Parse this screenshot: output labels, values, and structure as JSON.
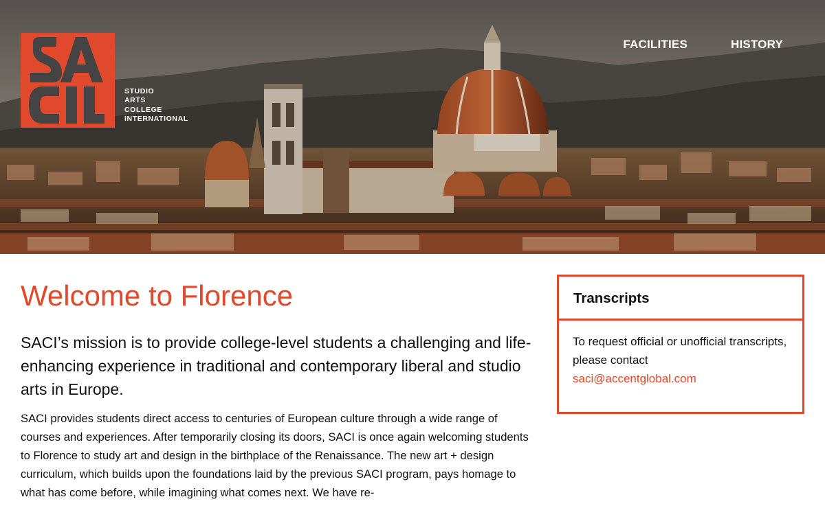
{
  "brand": {
    "logo_letters": "SACI",
    "tagline_lines": [
      "STUDIO",
      "ARTS",
      "COLLEGE",
      "INTERNATIONAL"
    ],
    "accent_color": "#e0492b"
  },
  "nav": {
    "items": [
      {
        "label": "FACILITIES"
      },
      {
        "label": "HISTORY"
      }
    ]
  },
  "hero": {
    "image": "florence-duomo-cityscape"
  },
  "main": {
    "title": "Welcome to Florence",
    "lead": "SACI’s mission is to provide college-level students a challenging and life-enhancing experience in traditional and contemporary liberal and studio arts in Europe.",
    "body": "SACI provides students direct access to centuries of European culture through a wide range of courses and experiences. After temporarily closing its doors, SACI is once again welcoming students to Florence to study art and design in the birthplace of the Renaissance. The new art + design curriculum, which builds upon the foundations laid by the previous SACI program, pays homage to what has come before, while imagining what comes next. We have re-"
  },
  "sidebar": {
    "transcripts": {
      "title": "Transcripts",
      "text": "To request official or unofficial transcripts, please contact",
      "email": "saci@accentglobal.com"
    }
  }
}
